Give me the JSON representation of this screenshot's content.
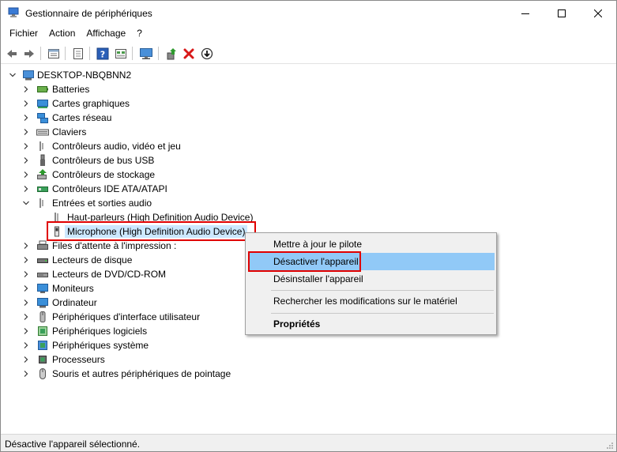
{
  "window": {
    "title": "Gestionnaire de périphériques"
  },
  "menu": [
    "Fichier",
    "Action",
    "Affichage",
    "?"
  ],
  "toolbar": {
    "buttons": [
      "back-arrow-icon",
      "forward-arrow-icon",
      "properties-sheet-icon",
      "device-list-icon",
      "help-icon",
      "view-icon",
      "monitor-icon",
      "update-driver-icon",
      "uninstall-x-icon",
      "download-arrow-icon"
    ]
  },
  "tree": {
    "root": "DESKTOP-NBQBNN2",
    "categories": [
      "Batteries",
      "Cartes graphiques",
      "Cartes réseau",
      "Claviers",
      "Contrôleurs audio, vidéo et jeu",
      "Contrôleurs de bus USB",
      "Contrôleurs de stockage",
      "Contrôleurs IDE ATA/ATAPI",
      "Entrées et sorties audio"
    ],
    "audio_children": [
      "Haut-parleurs (High Definition Audio Device)",
      "Microphone (High Definition Audio Device)"
    ],
    "categories_after": [
      "Files d'attente à l'impression :",
      "Lecteurs de disque",
      "Lecteurs de DVD/CD-ROM",
      "Moniteurs",
      "Ordinateur",
      "Périphériques d'interface utilisateur",
      "Périphériques logiciels",
      "Périphériques système",
      "Processeurs",
      "Souris et autres périphériques de pointage"
    ]
  },
  "context_menu": {
    "items": [
      "Mettre à jour le pilote",
      "Désactiver l'appareil",
      "Désinstaller l'appareil",
      "Rechercher les modifications sur le matériel",
      "Propriétés"
    ],
    "highlighted": "Désactiver l'appareil"
  },
  "status": {
    "text": "Désactive l'appareil sélectionné."
  },
  "colors": {
    "highlight": "#91c9f7",
    "selection": "#cce8ff",
    "annotation_red": "#e00000"
  }
}
